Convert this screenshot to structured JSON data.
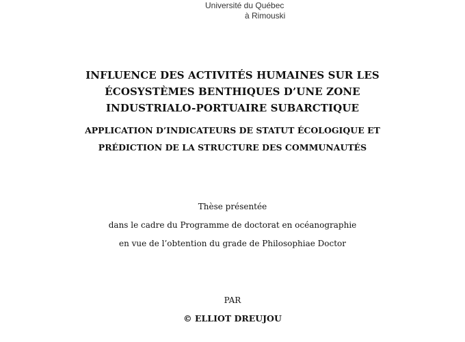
{
  "header": {
    "institution_line1": "Université du Québec",
    "institution_line2": "à Rimouski"
  },
  "title": {
    "lines": [
      "INFLUENCE DES ACTIVITÉS HUMAINES SUR LES",
      "ÉCOSYSTÈMES BENTHIQUES D’UNE ZONE",
      "INDUSTRIALO-PORTUAIRE SUBARCTIQUE"
    ]
  },
  "subtitle": {
    "lines": [
      "APPLICATION D’INDICATEURS DE STATUT ÉCOLOGIQUE ET",
      "PRÉDICTION DE LA STRUCTURE DES COMMUNAUTÉS"
    ]
  },
  "presentation": {
    "lines": [
      "Thèse présentée",
      "dans le cadre du Programme de doctorat en océanographie",
      "en vue de l’obtention du grade de Philosophiae Doctor"
    ]
  },
  "byline": {
    "par": "PAR",
    "author": "© ELLIOT DREUJOU"
  }
}
